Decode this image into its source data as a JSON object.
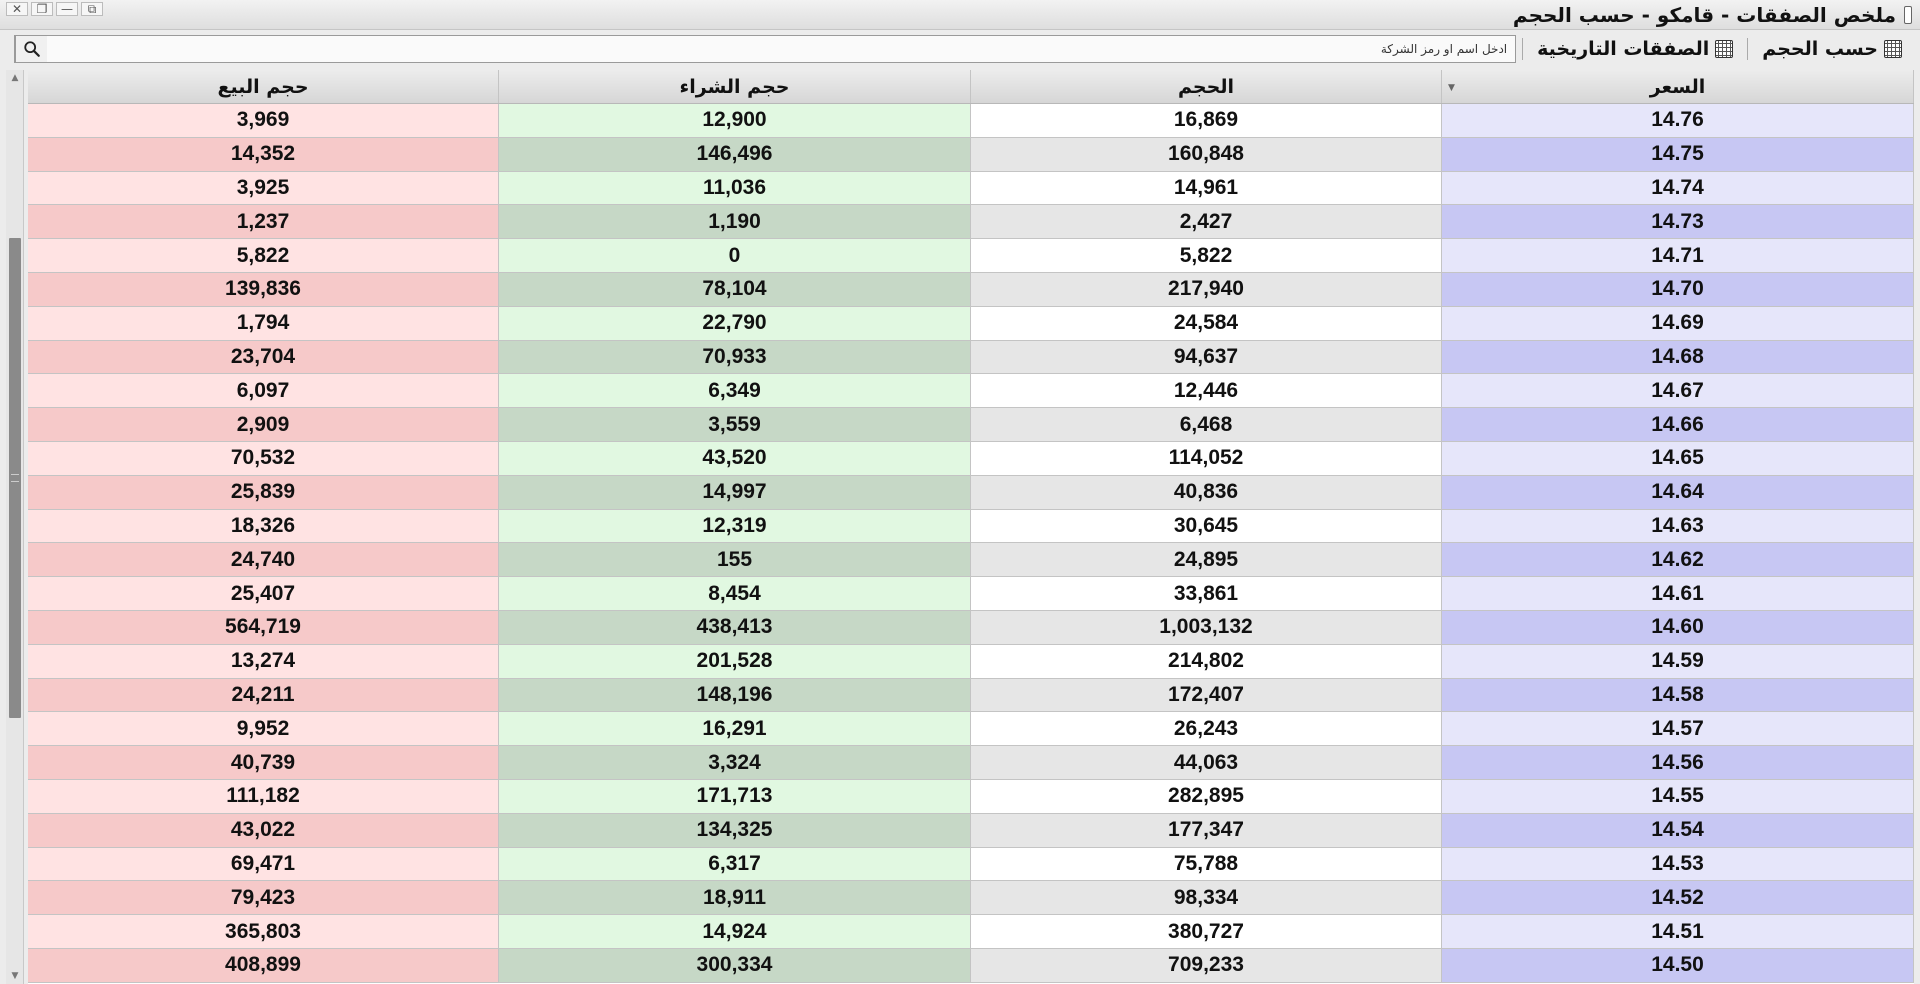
{
  "window": {
    "title": "ملخص الصفقات - قامكو - حسب الحجم",
    "controls": [
      "✕",
      "❐",
      "—",
      "⧉"
    ]
  },
  "toolbar": {
    "by_volume_label": "حسب الحجم",
    "historical_label": "الصفقات التاريخية",
    "search_placeholder": "ادخل اسم او رمز الشركة"
  },
  "table": {
    "columns": {
      "sell_volume": "حجم البيع",
      "buy_volume": "حجم الشراء",
      "volume": "الحجم",
      "price": "السعر"
    },
    "rows": [
      {
        "sell": "3,969",
        "buy": "12,900",
        "volume": "16,869",
        "price": "14.76"
      },
      {
        "sell": "14,352",
        "buy": "146,496",
        "volume": "160,848",
        "price": "14.75"
      },
      {
        "sell": "3,925",
        "buy": "11,036",
        "volume": "14,961",
        "price": "14.74"
      },
      {
        "sell": "1,237",
        "buy": "1,190",
        "volume": "2,427",
        "price": "14.73"
      },
      {
        "sell": "5,822",
        "buy": "0",
        "volume": "5,822",
        "price": "14.71"
      },
      {
        "sell": "139,836",
        "buy": "78,104",
        "volume": "217,940",
        "price": "14.70"
      },
      {
        "sell": "1,794",
        "buy": "22,790",
        "volume": "24,584",
        "price": "14.69"
      },
      {
        "sell": "23,704",
        "buy": "70,933",
        "volume": "94,637",
        "price": "14.68"
      },
      {
        "sell": "6,097",
        "buy": "6,349",
        "volume": "12,446",
        "price": "14.67"
      },
      {
        "sell": "2,909",
        "buy": "3,559",
        "volume": "6,468",
        "price": "14.66"
      },
      {
        "sell": "70,532",
        "buy": "43,520",
        "volume": "114,052",
        "price": "14.65"
      },
      {
        "sell": "25,839",
        "buy": "14,997",
        "volume": "40,836",
        "price": "14.64"
      },
      {
        "sell": "18,326",
        "buy": "12,319",
        "volume": "30,645",
        "price": "14.63"
      },
      {
        "sell": "24,740",
        "buy": "155",
        "volume": "24,895",
        "price": "14.62"
      },
      {
        "sell": "25,407",
        "buy": "8,454",
        "volume": "33,861",
        "price": "14.61"
      },
      {
        "sell": "564,719",
        "buy": "438,413",
        "volume": "1,003,132",
        "price": "14.60"
      },
      {
        "sell": "13,274",
        "buy": "201,528",
        "volume": "214,802",
        "price": "14.59"
      },
      {
        "sell": "24,211",
        "buy": "148,196",
        "volume": "172,407",
        "price": "14.58"
      },
      {
        "sell": "9,952",
        "buy": "16,291",
        "volume": "26,243",
        "price": "14.57"
      },
      {
        "sell": "40,739",
        "buy": "3,324",
        "volume": "44,063",
        "price": "14.56"
      },
      {
        "sell": "111,182",
        "buy": "171,713",
        "volume": "282,895",
        "price": "14.55"
      },
      {
        "sell": "43,022",
        "buy": "134,325",
        "volume": "177,347",
        "price": "14.54"
      },
      {
        "sell": "69,471",
        "buy": "6,317",
        "volume": "75,788",
        "price": "14.53"
      },
      {
        "sell": "79,423",
        "buy": "18,911",
        "volume": "98,334",
        "price": "14.52"
      },
      {
        "sell": "365,803",
        "buy": "14,924",
        "volume": "380,727",
        "price": "14.51"
      },
      {
        "sell": "408,899",
        "buy": "300,334",
        "volume": "709,233",
        "price": "14.50"
      }
    ]
  },
  "colors": {
    "sell_light": "#ffe3e3",
    "sell_dark": "#f6c9c9",
    "buy_light": "#e1f8e1",
    "buy_dark": "#c6d8c6",
    "price_light": "#e6e6fa",
    "price_dark": "#c7c7f3"
  }
}
